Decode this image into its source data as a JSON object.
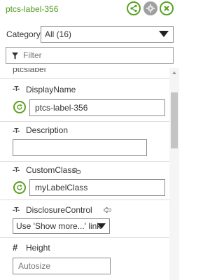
{
  "header": {
    "title": "ptcs-label-356"
  },
  "category": {
    "label": "Category",
    "selected": "All (16)"
  },
  "filter": {
    "placeholder": "Filter"
  },
  "props": {
    "partial_label": "ptcslabel",
    "display_name": {
      "label": "DisplayName",
      "value": "ptcs-label-356"
    },
    "description": {
      "label": "Description",
      "value": ""
    },
    "custom_class": {
      "label": "CustomClass",
      "value": "myLabelClass"
    },
    "disclosure_control": {
      "label": "DisclosureControl",
      "selected": "Use 'Show more...' link"
    },
    "height": {
      "label": "Height",
      "placeholder": "Autosize"
    }
  },
  "icons": {
    "type_text": "-T-",
    "type_number": "#"
  },
  "colors": {
    "accent": "#5aa123"
  }
}
